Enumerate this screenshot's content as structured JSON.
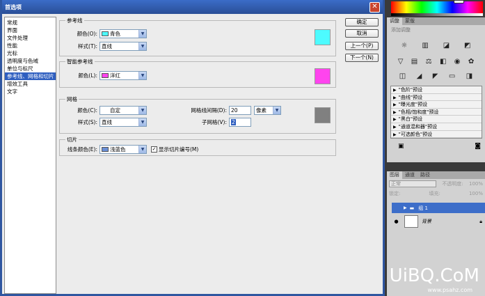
{
  "dialog": {
    "title": "首选项",
    "nav_items": [
      {
        "label": "常规",
        "active": false
      },
      {
        "label": "界面",
        "active": false
      },
      {
        "label": "文件处理",
        "active": false
      },
      {
        "label": "性能",
        "active": false
      },
      {
        "label": "光标",
        "active": false
      },
      {
        "label": "透明度与色域",
        "active": false
      },
      {
        "label": "单位与标尺",
        "active": false
      },
      {
        "label": "参考线、网格和切片",
        "active": true
      },
      {
        "label": "增效工具",
        "active": false
      },
      {
        "label": "文字",
        "active": false
      }
    ],
    "guides": {
      "title": "参考线",
      "color_label": "颜色(O):",
      "color_value": "青色",
      "style_label": "样式(T):",
      "style_value": "直线"
    },
    "smart_guides": {
      "title": "智能参考线",
      "color_label": "颜色(L):",
      "color_value": "洋红"
    },
    "grid": {
      "title": "网格",
      "color_label": "颜色(C):",
      "color_value": "自定",
      "style_label": "样式(S):",
      "style_value": "直线",
      "gridline_label": "网格线间隔(D):",
      "gridline_value": "20",
      "unit_value": "像素",
      "subdiv_label": "子网格(V):",
      "subdiv_value": "2"
    },
    "slices": {
      "title": "切片",
      "color_label": "线条颜色(E):",
      "color_value": "浅蓝色",
      "show_numbers_label": "显示切片编号(M)",
      "show_numbers_checked": true
    },
    "buttons": {
      "ok": "确定",
      "cancel": "取消",
      "prev": "上一个(P)",
      "next": "下一个(N)"
    }
  },
  "colors": {
    "guides": "#4dfbff",
    "smart_guides": "#ff44ee",
    "grid": "#808080",
    "slices": "#6a8fd6",
    "selection": "#2f5fc0"
  },
  "adjustments": {
    "tabs": [
      "调整",
      "蒙版"
    ],
    "hint": "添加调整",
    "presets": [
      "\"色阶\"预设",
      "\"曲线\"预设",
      "\"曝光度\"预设",
      "\"色相/饱和度\"预设",
      "\"黑白\"预设",
      "\"通道混和器\"预设",
      "\"可选颜色\"预设"
    ]
  },
  "layers": {
    "tabs": [
      "图层",
      "通道",
      "路径"
    ],
    "blend_mode": "正常",
    "opacity_label": "不透明度:",
    "opacity_value": "100%",
    "lock_label": "锁定:",
    "fill_label": "填充:",
    "fill_value": "100%",
    "items": [
      {
        "name": "组 1",
        "type": "group"
      },
      {
        "name": "背景",
        "type": "background"
      }
    ]
  },
  "watermark": {
    "main": "UiBQ.CoM",
    "sub": "www.psahz.com"
  }
}
